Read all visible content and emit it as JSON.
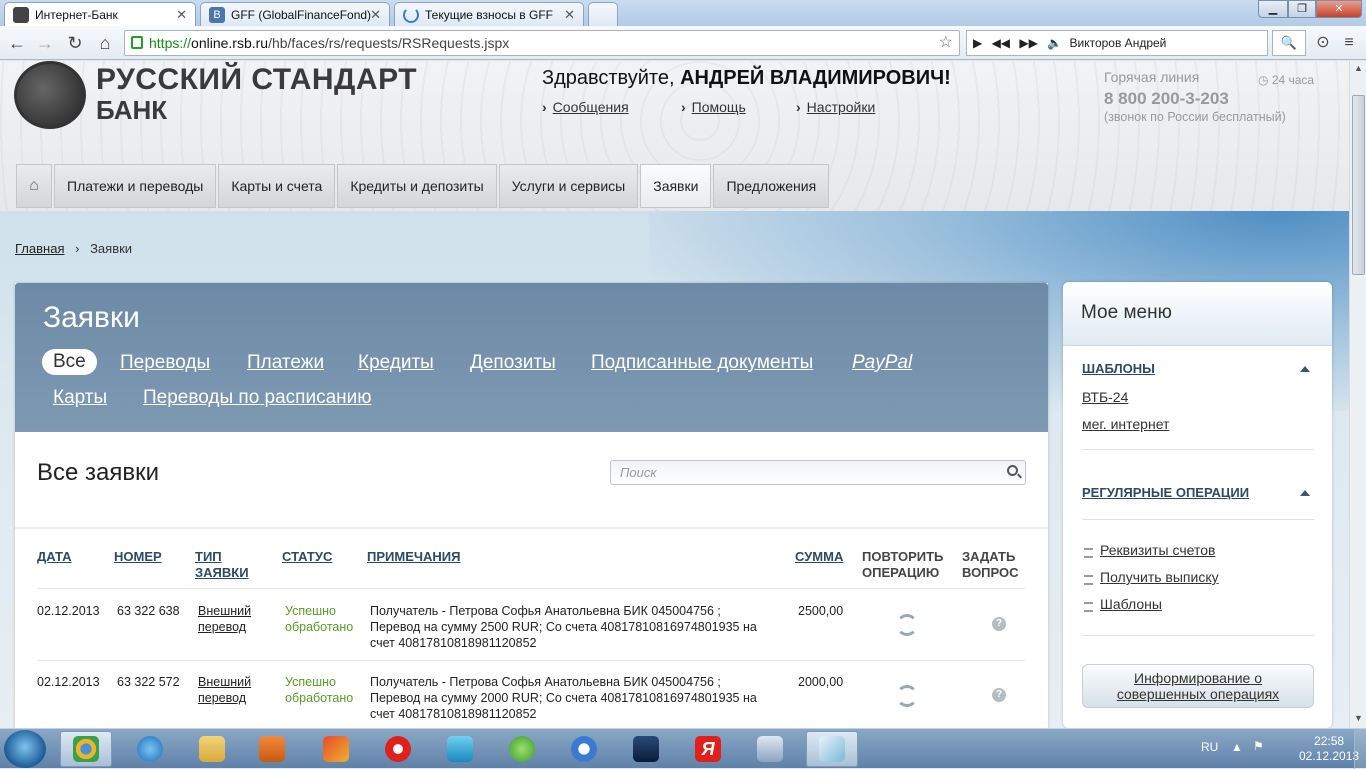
{
  "browser": {
    "tabs": [
      {
        "title": "Интернет-Банк",
        "favicon_color": "#444444"
      },
      {
        "title": "GFF (GlobalFinanceFond)",
        "favicon_color": "#4a76a8"
      },
      {
        "title": "Текущие взносы в GFF",
        "favicon_color": "#3b7bd0"
      }
    ],
    "url_scheme": "https://",
    "url_host": "online.rsb.ru",
    "url_path": "/hb/faces/rs/requests/RSRequests.jspx",
    "player_text": "Викторов Андрей",
    "controls": {
      "play": "▶",
      "prev": "◀◀",
      "next": "▶▶",
      "back": "←",
      "forward": "→",
      "reload": "↻",
      "home": "⌂",
      "star": "☆",
      "zoom": "🔍"
    }
  },
  "header": {
    "brand_line1": "РУССКИЙ СТАНДАРТ",
    "brand_line2": "БАНК",
    "greeting_prefix": "Здравствуйте, ",
    "greeting_name": "АНДРЕЙ ВЛАДИМИРОВИЧ!",
    "links": [
      "Сообщения",
      "Помощь",
      "Настройки"
    ],
    "hotline_label": "Горячая линия",
    "hotline_hours": "24 часа",
    "hotline_number": "8 800 200-3-203",
    "hotline_note": "(звонок по России бесплатный)"
  },
  "nav": {
    "items": [
      "Платежи и переводы",
      "Карты и счета",
      "Кредиты и депозиты",
      "Услуги и сервисы",
      "Заявки",
      "Предложения"
    ],
    "active": "Заявки"
  },
  "breadcrumb": {
    "home": "Главная",
    "separator": "›",
    "current": "Заявки"
  },
  "requests": {
    "title": "Заявки",
    "filters": [
      "Все",
      "Переводы",
      "Платежи",
      "Кредиты",
      "Депозиты",
      "Подписанные документы",
      "PayPal",
      "Карты",
      "Переводы по расписанию"
    ],
    "selected_filter": "Все",
    "list_title": "Все заявки",
    "search_placeholder": "Поиск",
    "columns": {
      "date": "ДАТА",
      "number": "НОМЕР",
      "type_1": "ТИП",
      "type_2": "ЗАЯВКИ",
      "status": "СТАТУС",
      "notes": "ПРИМЕЧАНИЯ",
      "sum": "СУММА",
      "repeat_1": "ПОВТОРИТЬ",
      "repeat_2": "ОПЕРАЦИЮ",
      "ask_1": "ЗАДАТЬ",
      "ask_2": "ВОПРОС"
    },
    "rows": [
      {
        "date": "02.12.2013",
        "number": "63 322 638",
        "type_1": "Внешний",
        "type_2": "перевод",
        "status_1": "Успешно",
        "status_2": "обработано",
        "note_1": "Получатель - Петрова Софья Анатольевна БИК 045004756 ;",
        "note_2": "Перевод на сумму 2500 RUR; Со счета 40817810816974801935 на",
        "note_3": "счет 40817810818981120852",
        "sum": "2500,00",
        "ask": "?"
      },
      {
        "date": "02.12.2013",
        "number": "63 322 572",
        "type_1": "Внешний",
        "type_2": "перевод",
        "status_1": "Успешно",
        "status_2": "обработано",
        "note_1": "Получатель - Петрова Софья Анатольевна БИК 045004756 ;",
        "note_2": "Перевод на сумму 2000 RUR; Со счета 40817810816974801935 на",
        "note_3": "счет 40817810818981120852",
        "sum": "2000,00",
        "ask": "?"
      }
    ]
  },
  "side_menu": {
    "title": "Мое меню",
    "templates_header": "ШАБЛОНЫ",
    "templates": [
      "ВТБ-24",
      "мег. интернет"
    ],
    "regular_header": "РЕГУЛЯРНЫЕ ОПЕРАЦИИ",
    "regular": [
      "Реквизиты счетов",
      "Получить выписку",
      "Шаблоны"
    ],
    "info_button_1": "Информирование о",
    "info_button_2": "совершенных операциях"
  },
  "taskbar": {
    "apps": [
      "chrome",
      "ie",
      "explorer",
      "media-player",
      "paint",
      "yandex-browser",
      "music",
      "downloader",
      "media-center",
      "kmplayer",
      "yandex",
      "volume",
      "notepad"
    ],
    "active_app": "chrome",
    "lang": "RU",
    "time": "22:58",
    "date": "02.12.2013"
  },
  "colors": {
    "accent_link": "#2d4a63",
    "status_ok": "#5a9a2a",
    "panel_header": "#7390ab"
  }
}
